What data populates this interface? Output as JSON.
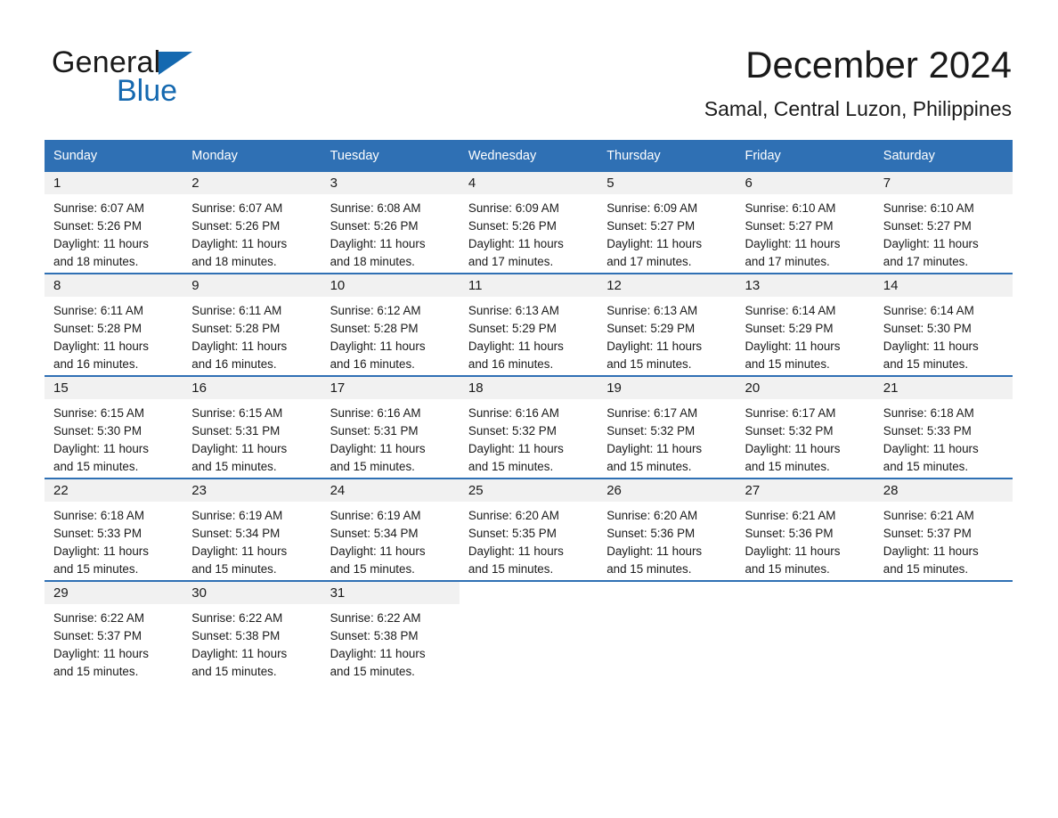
{
  "brand": {
    "name_part1": "General",
    "name_part2": "Blue",
    "triangle_color": "#1569b0",
    "text_color": "#1a1a1a"
  },
  "header": {
    "title": "December 2024",
    "location": "Samal, Central Luzon, Philippines"
  },
  "colors": {
    "header_blue": "#2f70b4",
    "daynum_band": "#f1f1f1",
    "text": "#1a1a1a",
    "row_divider": "#2f70b4"
  },
  "weekday_headers": [
    "Sunday",
    "Monday",
    "Tuesday",
    "Wednesday",
    "Thursday",
    "Friday",
    "Saturday"
  ],
  "labels": {
    "sunrise_prefix": "Sunrise:",
    "sunset_prefix": "Sunset:",
    "daylight_prefix": "Daylight:"
  },
  "weeks": [
    [
      {
        "day": "1",
        "sunrise": "Sunrise: 6:07 AM",
        "sunset": "Sunset: 5:26 PM",
        "daylight_line1": "Daylight: 11 hours",
        "daylight_line2": "and 18 minutes."
      },
      {
        "day": "2",
        "sunrise": "Sunrise: 6:07 AM",
        "sunset": "Sunset: 5:26 PM",
        "daylight_line1": "Daylight: 11 hours",
        "daylight_line2": "and 18 minutes."
      },
      {
        "day": "3",
        "sunrise": "Sunrise: 6:08 AM",
        "sunset": "Sunset: 5:26 PM",
        "daylight_line1": "Daylight: 11 hours",
        "daylight_line2": "and 18 minutes."
      },
      {
        "day": "4",
        "sunrise": "Sunrise: 6:09 AM",
        "sunset": "Sunset: 5:26 PM",
        "daylight_line1": "Daylight: 11 hours",
        "daylight_line2": "and 17 minutes."
      },
      {
        "day": "5",
        "sunrise": "Sunrise: 6:09 AM",
        "sunset": "Sunset: 5:27 PM",
        "daylight_line1": "Daylight: 11 hours",
        "daylight_line2": "and 17 minutes."
      },
      {
        "day": "6",
        "sunrise": "Sunrise: 6:10 AM",
        "sunset": "Sunset: 5:27 PM",
        "daylight_line1": "Daylight: 11 hours",
        "daylight_line2": "and 17 minutes."
      },
      {
        "day": "7",
        "sunrise": "Sunrise: 6:10 AM",
        "sunset": "Sunset: 5:27 PM",
        "daylight_line1": "Daylight: 11 hours",
        "daylight_line2": "and 17 minutes."
      }
    ],
    [
      {
        "day": "8",
        "sunrise": "Sunrise: 6:11 AM",
        "sunset": "Sunset: 5:28 PM",
        "daylight_line1": "Daylight: 11 hours",
        "daylight_line2": "and 16 minutes."
      },
      {
        "day": "9",
        "sunrise": "Sunrise: 6:11 AM",
        "sunset": "Sunset: 5:28 PM",
        "daylight_line1": "Daylight: 11 hours",
        "daylight_line2": "and 16 minutes."
      },
      {
        "day": "10",
        "sunrise": "Sunrise: 6:12 AM",
        "sunset": "Sunset: 5:28 PM",
        "daylight_line1": "Daylight: 11 hours",
        "daylight_line2": "and 16 minutes."
      },
      {
        "day": "11",
        "sunrise": "Sunrise: 6:13 AM",
        "sunset": "Sunset: 5:29 PM",
        "daylight_line1": "Daylight: 11 hours",
        "daylight_line2": "and 16 minutes."
      },
      {
        "day": "12",
        "sunrise": "Sunrise: 6:13 AM",
        "sunset": "Sunset: 5:29 PM",
        "daylight_line1": "Daylight: 11 hours",
        "daylight_line2": "and 15 minutes."
      },
      {
        "day": "13",
        "sunrise": "Sunrise: 6:14 AM",
        "sunset": "Sunset: 5:29 PM",
        "daylight_line1": "Daylight: 11 hours",
        "daylight_line2": "and 15 minutes."
      },
      {
        "day": "14",
        "sunrise": "Sunrise: 6:14 AM",
        "sunset": "Sunset: 5:30 PM",
        "daylight_line1": "Daylight: 11 hours",
        "daylight_line2": "and 15 minutes."
      }
    ],
    [
      {
        "day": "15",
        "sunrise": "Sunrise: 6:15 AM",
        "sunset": "Sunset: 5:30 PM",
        "daylight_line1": "Daylight: 11 hours",
        "daylight_line2": "and 15 minutes."
      },
      {
        "day": "16",
        "sunrise": "Sunrise: 6:15 AM",
        "sunset": "Sunset: 5:31 PM",
        "daylight_line1": "Daylight: 11 hours",
        "daylight_line2": "and 15 minutes."
      },
      {
        "day": "17",
        "sunrise": "Sunrise: 6:16 AM",
        "sunset": "Sunset: 5:31 PM",
        "daylight_line1": "Daylight: 11 hours",
        "daylight_line2": "and 15 minutes."
      },
      {
        "day": "18",
        "sunrise": "Sunrise: 6:16 AM",
        "sunset": "Sunset: 5:32 PM",
        "daylight_line1": "Daylight: 11 hours",
        "daylight_line2": "and 15 minutes."
      },
      {
        "day": "19",
        "sunrise": "Sunrise: 6:17 AM",
        "sunset": "Sunset: 5:32 PM",
        "daylight_line1": "Daylight: 11 hours",
        "daylight_line2": "and 15 minutes."
      },
      {
        "day": "20",
        "sunrise": "Sunrise: 6:17 AM",
        "sunset": "Sunset: 5:32 PM",
        "daylight_line1": "Daylight: 11 hours",
        "daylight_line2": "and 15 minutes."
      },
      {
        "day": "21",
        "sunrise": "Sunrise: 6:18 AM",
        "sunset": "Sunset: 5:33 PM",
        "daylight_line1": "Daylight: 11 hours",
        "daylight_line2": "and 15 minutes."
      }
    ],
    [
      {
        "day": "22",
        "sunrise": "Sunrise: 6:18 AM",
        "sunset": "Sunset: 5:33 PM",
        "daylight_line1": "Daylight: 11 hours",
        "daylight_line2": "and 15 minutes."
      },
      {
        "day": "23",
        "sunrise": "Sunrise: 6:19 AM",
        "sunset": "Sunset: 5:34 PM",
        "daylight_line1": "Daylight: 11 hours",
        "daylight_line2": "and 15 minutes."
      },
      {
        "day": "24",
        "sunrise": "Sunrise: 6:19 AM",
        "sunset": "Sunset: 5:34 PM",
        "daylight_line1": "Daylight: 11 hours",
        "daylight_line2": "and 15 minutes."
      },
      {
        "day": "25",
        "sunrise": "Sunrise: 6:20 AM",
        "sunset": "Sunset: 5:35 PM",
        "daylight_line1": "Daylight: 11 hours",
        "daylight_line2": "and 15 minutes."
      },
      {
        "day": "26",
        "sunrise": "Sunrise: 6:20 AM",
        "sunset": "Sunset: 5:36 PM",
        "daylight_line1": "Daylight: 11 hours",
        "daylight_line2": "and 15 minutes."
      },
      {
        "day": "27",
        "sunrise": "Sunrise: 6:21 AM",
        "sunset": "Sunset: 5:36 PM",
        "daylight_line1": "Daylight: 11 hours",
        "daylight_line2": "and 15 minutes."
      },
      {
        "day": "28",
        "sunrise": "Sunrise: 6:21 AM",
        "sunset": "Sunset: 5:37 PM",
        "daylight_line1": "Daylight: 11 hours",
        "daylight_line2": "and 15 minutes."
      }
    ],
    [
      {
        "day": "29",
        "sunrise": "Sunrise: 6:22 AM",
        "sunset": "Sunset: 5:37 PM",
        "daylight_line1": "Daylight: 11 hours",
        "daylight_line2": "and 15 minutes."
      },
      {
        "day": "30",
        "sunrise": "Sunrise: 6:22 AM",
        "sunset": "Sunset: 5:38 PM",
        "daylight_line1": "Daylight: 11 hours",
        "daylight_line2": "and 15 minutes."
      },
      {
        "day": "31",
        "sunrise": "Sunrise: 6:22 AM",
        "sunset": "Sunset: 5:38 PM",
        "daylight_line1": "Daylight: 11 hours",
        "daylight_line2": "and 15 minutes."
      },
      {
        "day": "",
        "sunrise": "",
        "sunset": "",
        "daylight_line1": "",
        "daylight_line2": ""
      },
      {
        "day": "",
        "sunrise": "",
        "sunset": "",
        "daylight_line1": "",
        "daylight_line2": ""
      },
      {
        "day": "",
        "sunrise": "",
        "sunset": "",
        "daylight_line1": "",
        "daylight_line2": ""
      },
      {
        "day": "",
        "sunrise": "",
        "sunset": "",
        "daylight_line1": "",
        "daylight_line2": ""
      }
    ]
  ]
}
